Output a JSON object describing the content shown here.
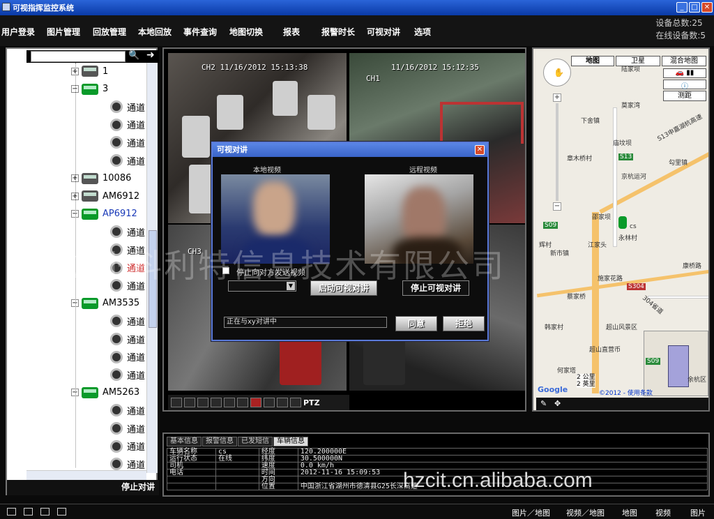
{
  "window": {
    "title": "可视指挥监控系统"
  },
  "menu": {
    "items": [
      "用户登录",
      "图片管理",
      "回放管理",
      "本地回放",
      "事件查询",
      "地图切换",
      "报表",
      "报警时长",
      "可视对讲",
      "选项"
    ]
  },
  "device_stats": {
    "total": "设备总数:25",
    "online": "在线设备数:5"
  },
  "tree": {
    "nodes": [
      {
        "label": "1",
        "type": "vehicle-offline",
        "expander": "+"
      },
      {
        "label": "3",
        "type": "vehicle-online",
        "expander": "−"
      },
      {
        "label": "通道",
        "type": "channel"
      },
      {
        "label": "通道",
        "type": "channel"
      },
      {
        "label": "通道",
        "type": "channel"
      },
      {
        "label": "通道",
        "type": "channel"
      },
      {
        "label": "10086",
        "type": "vehicle-offline",
        "expander": "+"
      },
      {
        "label": "AM6912",
        "type": "vehicle-offline",
        "expander": "+"
      },
      {
        "label": "AP6912",
        "type": "vehicle-online",
        "expander": "−"
      },
      {
        "label": "通道",
        "type": "channel"
      },
      {
        "label": "通道",
        "type": "channel"
      },
      {
        "label": "通道",
        "type": "channel"
      },
      {
        "label": "通道",
        "type": "channel"
      },
      {
        "label": "AM3535",
        "type": "vehicle-online",
        "expander": "−"
      },
      {
        "label": "通道",
        "type": "channel"
      },
      {
        "label": "通道",
        "type": "channel"
      },
      {
        "label": "通道",
        "type": "channel"
      },
      {
        "label": "通道",
        "type": "channel"
      },
      {
        "label": "AM5263",
        "type": "vehicle-online",
        "expander": "−"
      },
      {
        "label": "通道",
        "type": "channel"
      },
      {
        "label": "通道",
        "type": "channel"
      },
      {
        "label": "通道",
        "type": "channel"
      },
      {
        "label": "通道",
        "type": "channel"
      }
    ],
    "stop_talk": "停止对讲"
  },
  "video": {
    "cells": [
      {
        "osd": "CH2 11/16/2012 15:13:38"
      },
      {
        "osd": "CH1",
        "osd2": "11/16/2012 15:12:35"
      },
      {
        "osd": "CH3"
      },
      {
        "osd": ""
      }
    ],
    "ptz": "PTZ"
  },
  "map": {
    "buttons": [
      "地图",
      "卫星",
      "混合地图"
    ],
    "measure": "测距",
    "labels": [
      "陆家坝",
      "莫家湾",
      "下舍镇",
      "庙坟坝",
      "章木桥村",
      "勾里镇",
      "京杭运河",
      "S13申嘉湖杭高速",
      "S13",
      "S09",
      "邵家坝",
      "cs",
      "永林村",
      "辉村",
      "江家头",
      "新市镇",
      "康桥路",
      "施家花路",
      "S304",
      "304省道",
      "蔡家桥",
      "韩家村",
      "超山风景区",
      "超山直营币",
      "何家塔",
      "余杭区"
    ],
    "scale": [
      "2 公里",
      "2 英里"
    ],
    "copyright": "©2012 - 使用条款"
  },
  "info": {
    "tabs": [
      "基本信息",
      "报警信息",
      "已发短信",
      "车辆信息"
    ],
    "rows": [
      [
        "车辆名称",
        "cs",
        "经度",
        "120.200000E"
      ],
      [
        "运行状态",
        "在线",
        "纬度",
        "30.500000N"
      ],
      [
        "司机",
        "",
        "速度",
        "0.0 km/h"
      ],
      [
        "电话",
        "",
        "时间",
        "2012-11-16 15:09:53"
      ],
      [
        "",
        "",
        "方向",
        ""
      ],
      [
        "",
        "",
        "位置",
        "中国浙江省湖州市德清县G25长深高速"
      ]
    ]
  },
  "statusbar": {
    "buttons": [
      "图片／地图",
      "视频／地图",
      "地图",
      "视频",
      "图片"
    ]
  },
  "dialog": {
    "title": "可视对讲",
    "local_label": "本地视频",
    "remote_label": "远程视频",
    "checkbox_label": "停止向对方发送视频",
    "start_button": "启动可视对讲",
    "stop_button": "停止可视对讲",
    "status": "正在与xy对讲中",
    "accept_button": "同意",
    "reject_button": "拒绝"
  },
  "watermarks": {
    "company": "杭州科利特信息技术有限公司",
    "site": "hzcit.cn.alibaba.com"
  },
  "colors": {
    "titlebar": "#2a64d8",
    "online": "#0a9a2a",
    "offline": "#555555",
    "dialog_border": "#5a7ad8"
  }
}
